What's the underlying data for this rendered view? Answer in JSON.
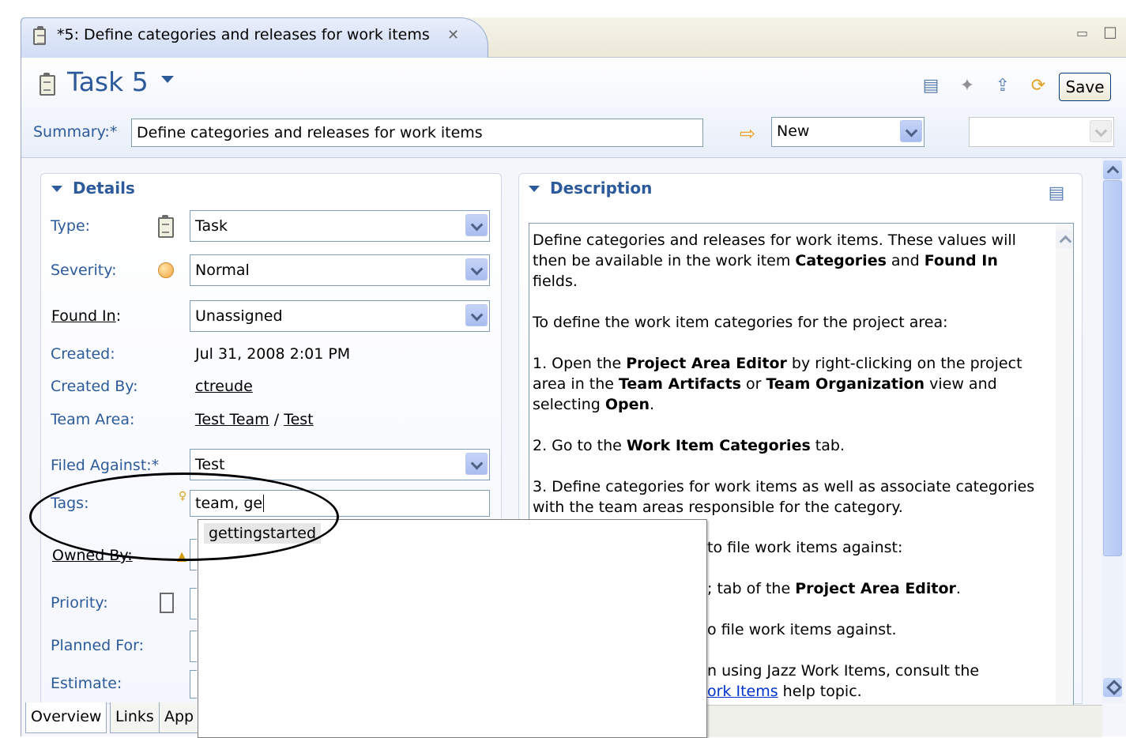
{
  "editor_tab": {
    "title": "*5: Define categories and releases for work items"
  },
  "header": {
    "title": "Task 5",
    "save_label": "Save",
    "summary_label": "Summary:*",
    "summary_value": "Define categories and releases for work items",
    "state_value": "New",
    "resolution_value": ""
  },
  "details": {
    "heading": "Details",
    "type_label": "Type:",
    "type_value": "Task",
    "severity_label": "Severity:",
    "severity_value": "Normal",
    "found_in_label": "Found In",
    "found_in_colon": ":",
    "found_in_value": "Unassigned",
    "created_label": "Created:",
    "created_value": "Jul 31, 2008 2:01 PM",
    "created_by_label": "Created By:",
    "created_by_value": "ctreude",
    "team_area_label": "Team Area:",
    "team_area_team": "Test Team",
    "team_area_sep": "/",
    "team_area_area": "Test",
    "filed_against_label": "Filed Against:*",
    "filed_against_value": "Test",
    "tags_label": "Tags:",
    "tags_value": "team, ge",
    "owned_by_label": "Owned By:",
    "priority_label": "Priority:",
    "planned_for_label": "Planned For:",
    "estimate_label": "Estimate:"
  },
  "autocomplete": {
    "suggestion": "gettingstarted"
  },
  "description": {
    "heading": "Description",
    "p1_a": "Define categories and releases for work items. These values will then be available in the work item ",
    "p1_b": "Categories",
    "p1_c": " and ",
    "p1_d": "Found In",
    "p1_e": " fields.",
    "p2": "To define the work item categories for the project area:",
    "p3_a": "1. Open the ",
    "p3_b": "Project Area Editor",
    "p3_c": " by right-clicking on the project area in the ",
    "p3_d": "Team Artifacts",
    "p3_e": " or ",
    "p3_f": "Team Organization",
    "p3_g": " view and selecting ",
    "p3_h": "Open",
    "p3_i": ".",
    "p4_a": "2. Go to the ",
    "p4_b": "Work Item Categories",
    "p4_c": " tab.",
    "p5": "3. Define categories for work items as well as associate categories with the team areas responsible for the category.",
    "frag1": "to file work items against:",
    "frag2_a": "; tab of the ",
    "frag2_b": "Project Area Editor",
    "frag2_c": ".",
    "frag3": "o file work items against.",
    "frag4": "n using Jazz Work Items, consult the",
    "frag5_link": "ork Items",
    "frag5_rest": " help topic."
  },
  "bottom_tabs": {
    "overview": "Overview",
    "links": "Links",
    "approvals": "App"
  }
}
